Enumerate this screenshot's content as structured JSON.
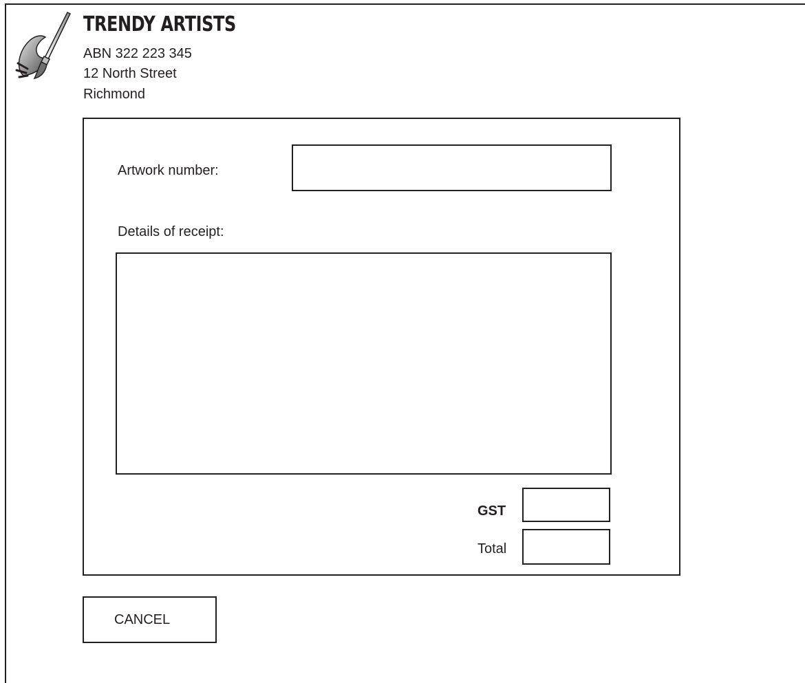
{
  "header": {
    "company_name": "TRENDY ARTISTS",
    "abn": "ABN 322 223 345",
    "street": "12 North Street",
    "suburb": "Richmond",
    "logo_icon": "paintbrush-icon"
  },
  "form": {
    "artwork_number": {
      "label": "Artwork number:",
      "value": ""
    },
    "details_of_receipt": {
      "label": "Details of receipt:",
      "value": ""
    },
    "gst": {
      "label": "GST",
      "value": ""
    },
    "total": {
      "label": "Total",
      "value": ""
    }
  },
  "actions": {
    "cancel_label": "CANCEL"
  },
  "colors": {
    "ink": "#231f20",
    "background": "#ffffff"
  }
}
